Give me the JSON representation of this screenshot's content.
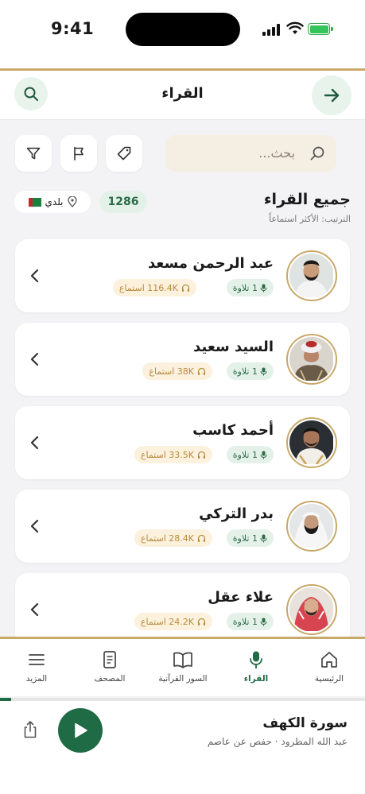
{
  "status_bar": {
    "time": "9:41"
  },
  "header": {
    "title": "القراء"
  },
  "search": {
    "placeholder": "بحث..."
  },
  "section": {
    "title": "جميع القراء",
    "sort_label": "الترتيب: الأكثر استماعاً",
    "count": "1286",
    "country_label": "بلدي"
  },
  "readers": [
    {
      "name": "عبد الرحمن مسعد",
      "recitations": "1 تلاوة",
      "listens": "116.4K استماع"
    },
    {
      "name": "السيد سعيد",
      "recitations": "1 تلاوة",
      "listens": "38K استماع"
    },
    {
      "name": "أحمد كاسب",
      "recitations": "1 تلاوة",
      "listens": "33.5K استماع"
    },
    {
      "name": "بدر التركي",
      "recitations": "1 تلاوة",
      "listens": "28.4K استماع"
    },
    {
      "name": "علاء عقل",
      "recitations": "1 تلاوة",
      "listens": "24.2K استماع"
    }
  ],
  "tabs": [
    {
      "label": "الرئيسية",
      "icon": "home-icon"
    },
    {
      "label": "القراء",
      "icon": "microphone-icon",
      "active": true
    },
    {
      "label": "السور القرآنية",
      "icon": "open-book-icon"
    },
    {
      "label": "المصحف",
      "icon": "document-icon"
    },
    {
      "label": "المزيد",
      "icon": "menu-icon"
    }
  ],
  "player": {
    "title": "سورة الكهف",
    "subtitle": "عبد الله المطرود · حفص عن عاصم",
    "progress_fraction": 0.03
  },
  "colors": {
    "accent": "#1f6b45",
    "gold": "#c8a96a",
    "recitation_bg": "#e4f1e9",
    "listen_bg": "#fbf1dd"
  }
}
